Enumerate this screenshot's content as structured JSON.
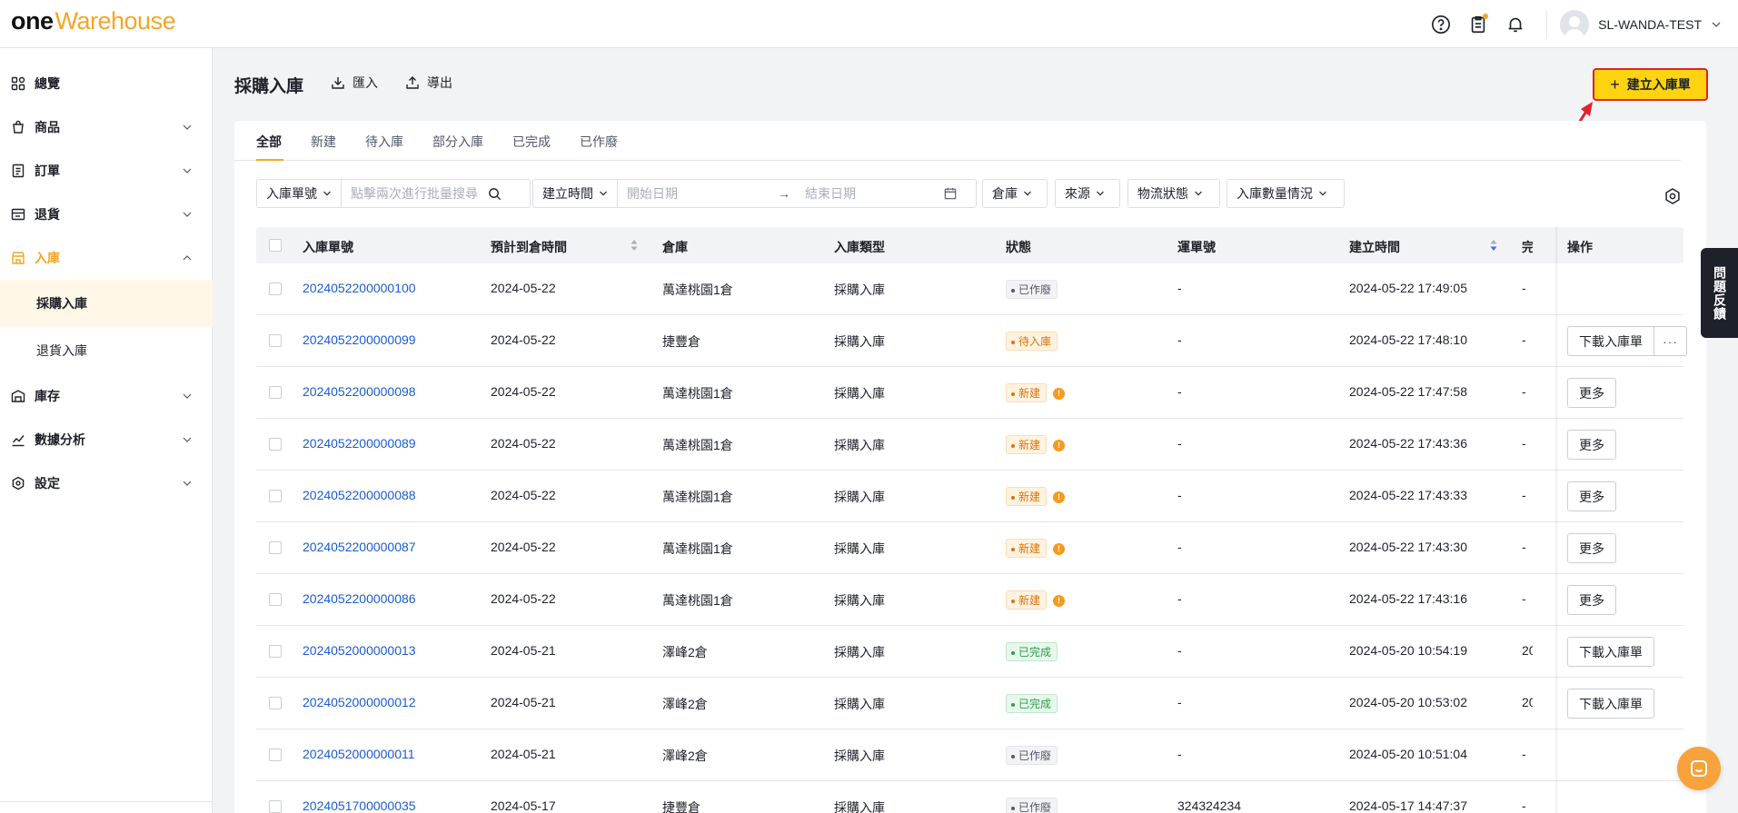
{
  "brand": {
    "one": "one",
    "warehouse": "Warehouse"
  },
  "header": {
    "user_name": "SL-WANDA-TEST"
  },
  "sidebar": {
    "items": [
      {
        "label": "總覽",
        "icon": "dashboard-icon"
      },
      {
        "label": "商品",
        "icon": "product-icon"
      },
      {
        "label": "訂單",
        "icon": "order-icon"
      },
      {
        "label": "退貨",
        "icon": "return-icon"
      },
      {
        "label": "入庫",
        "icon": "inbound-icon"
      },
      {
        "label": "庫存",
        "icon": "inventory-icon"
      },
      {
        "label": "數據分析",
        "icon": "analytics-icon"
      },
      {
        "label": "設定",
        "icon": "settings-icon"
      }
    ],
    "sub_items": [
      {
        "label": "採購入庫",
        "active": true
      },
      {
        "label": "退貨入庫",
        "active": false
      }
    ]
  },
  "page": {
    "title": "採購入庫",
    "import_label": "匯入",
    "export_label": "導出",
    "create_label": "建立入庫單"
  },
  "tabs": [
    "全部",
    "新建",
    "待入庫",
    "部分入庫",
    "已完成",
    "已作廢"
  ],
  "filters": {
    "order_no_select": "入庫單號",
    "search_placeholder": "點擊兩次進行批量搜尋",
    "created_time_select": "建立時間",
    "start_date_placeholder": "開始日期",
    "end_date_placeholder": "結束日期",
    "warehouse_select": "倉庫",
    "source_select": "來源",
    "logistics_select": "物流狀態",
    "quantity_select": "入庫數量情況"
  },
  "table": {
    "columns": [
      "入庫單號",
      "預計到倉時間",
      "倉庫",
      "入庫類型",
      "狀態",
      "運單號",
      "建立時間",
      "完",
      "操作"
    ],
    "rows": [
      {
        "no": "2024052200000100",
        "eta": "2024-05-22",
        "warehouse": "萬達桃園1倉",
        "type": "採購入庫",
        "status": "已作廢",
        "status_kind": "void",
        "warn": false,
        "waybill": "-",
        "created": "2024-05-22 17:49:05",
        "done": "-",
        "actions": []
      },
      {
        "no": "2024052200000099",
        "eta": "2024-05-22",
        "warehouse": "捷豐倉",
        "type": "採購入庫",
        "status": "待入庫",
        "status_kind": "wait",
        "warn": false,
        "waybill": "-",
        "created": "2024-05-22 17:48:10",
        "done": "-",
        "actions": [
          "下載入庫單",
          "···"
        ]
      },
      {
        "no": "2024052200000098",
        "eta": "2024-05-22",
        "warehouse": "萬達桃園1倉",
        "type": "採購入庫",
        "status": "新建",
        "status_kind": "new",
        "warn": true,
        "waybill": "-",
        "created": "2024-05-22 17:47:58",
        "done": "-",
        "actions": [
          "更多"
        ]
      },
      {
        "no": "2024052200000089",
        "eta": "2024-05-22",
        "warehouse": "萬達桃園1倉",
        "type": "採購入庫",
        "status": "新建",
        "status_kind": "new",
        "warn": true,
        "waybill": "-",
        "created": "2024-05-22 17:43:36",
        "done": "-",
        "actions": [
          "更多"
        ]
      },
      {
        "no": "2024052200000088",
        "eta": "2024-05-22",
        "warehouse": "萬達桃園1倉",
        "type": "採購入庫",
        "status": "新建",
        "status_kind": "new",
        "warn": true,
        "waybill": "-",
        "created": "2024-05-22 17:43:33",
        "done": "-",
        "actions": [
          "更多"
        ]
      },
      {
        "no": "2024052200000087",
        "eta": "2024-05-22",
        "warehouse": "萬達桃園1倉",
        "type": "採購入庫",
        "status": "新建",
        "status_kind": "new",
        "warn": true,
        "waybill": "-",
        "created": "2024-05-22 17:43:30",
        "done": "-",
        "actions": [
          "更多"
        ]
      },
      {
        "no": "2024052200000086",
        "eta": "2024-05-22",
        "warehouse": "萬達桃園1倉",
        "type": "採購入庫",
        "status": "新建",
        "status_kind": "new",
        "warn": true,
        "waybill": "-",
        "created": "2024-05-22 17:43:16",
        "done": "-",
        "actions": [
          "更多"
        ]
      },
      {
        "no": "2024052000000013",
        "eta": "2024-05-21",
        "warehouse": "澤峰2倉",
        "type": "採購入庫",
        "status": "已完成",
        "status_kind": "done",
        "warn": false,
        "waybill": "-",
        "created": "2024-05-20 10:54:19",
        "done": "20",
        "actions": [
          "下載入庫單"
        ]
      },
      {
        "no": "2024052000000012",
        "eta": "2024-05-21",
        "warehouse": "澤峰2倉",
        "type": "採購入庫",
        "status": "已完成",
        "status_kind": "done",
        "warn": false,
        "waybill": "-",
        "created": "2024-05-20 10:53:02",
        "done": "20",
        "actions": [
          "下載入庫單"
        ]
      },
      {
        "no": "2024052000000011",
        "eta": "2024-05-21",
        "warehouse": "澤峰2倉",
        "type": "採購入庫",
        "status": "已作廢",
        "status_kind": "void",
        "warn": false,
        "waybill": "-",
        "created": "2024-05-20 10:51:04",
        "done": "-",
        "actions": []
      },
      {
        "no": "2024051700000035",
        "eta": "2024-05-17",
        "warehouse": "捷豐倉",
        "type": "採購入庫",
        "status": "已作廢",
        "status_kind": "void",
        "warn": false,
        "waybill": "324324234",
        "created": "2024-05-17 14:47:37",
        "done": "-",
        "actions": []
      }
    ]
  },
  "feedback": "問題反饋",
  "colors": {
    "accent": "#f5a623",
    "create_button": "#fdd40f",
    "annotation_red": "#e2202c",
    "link": "#1a5bd6"
  }
}
